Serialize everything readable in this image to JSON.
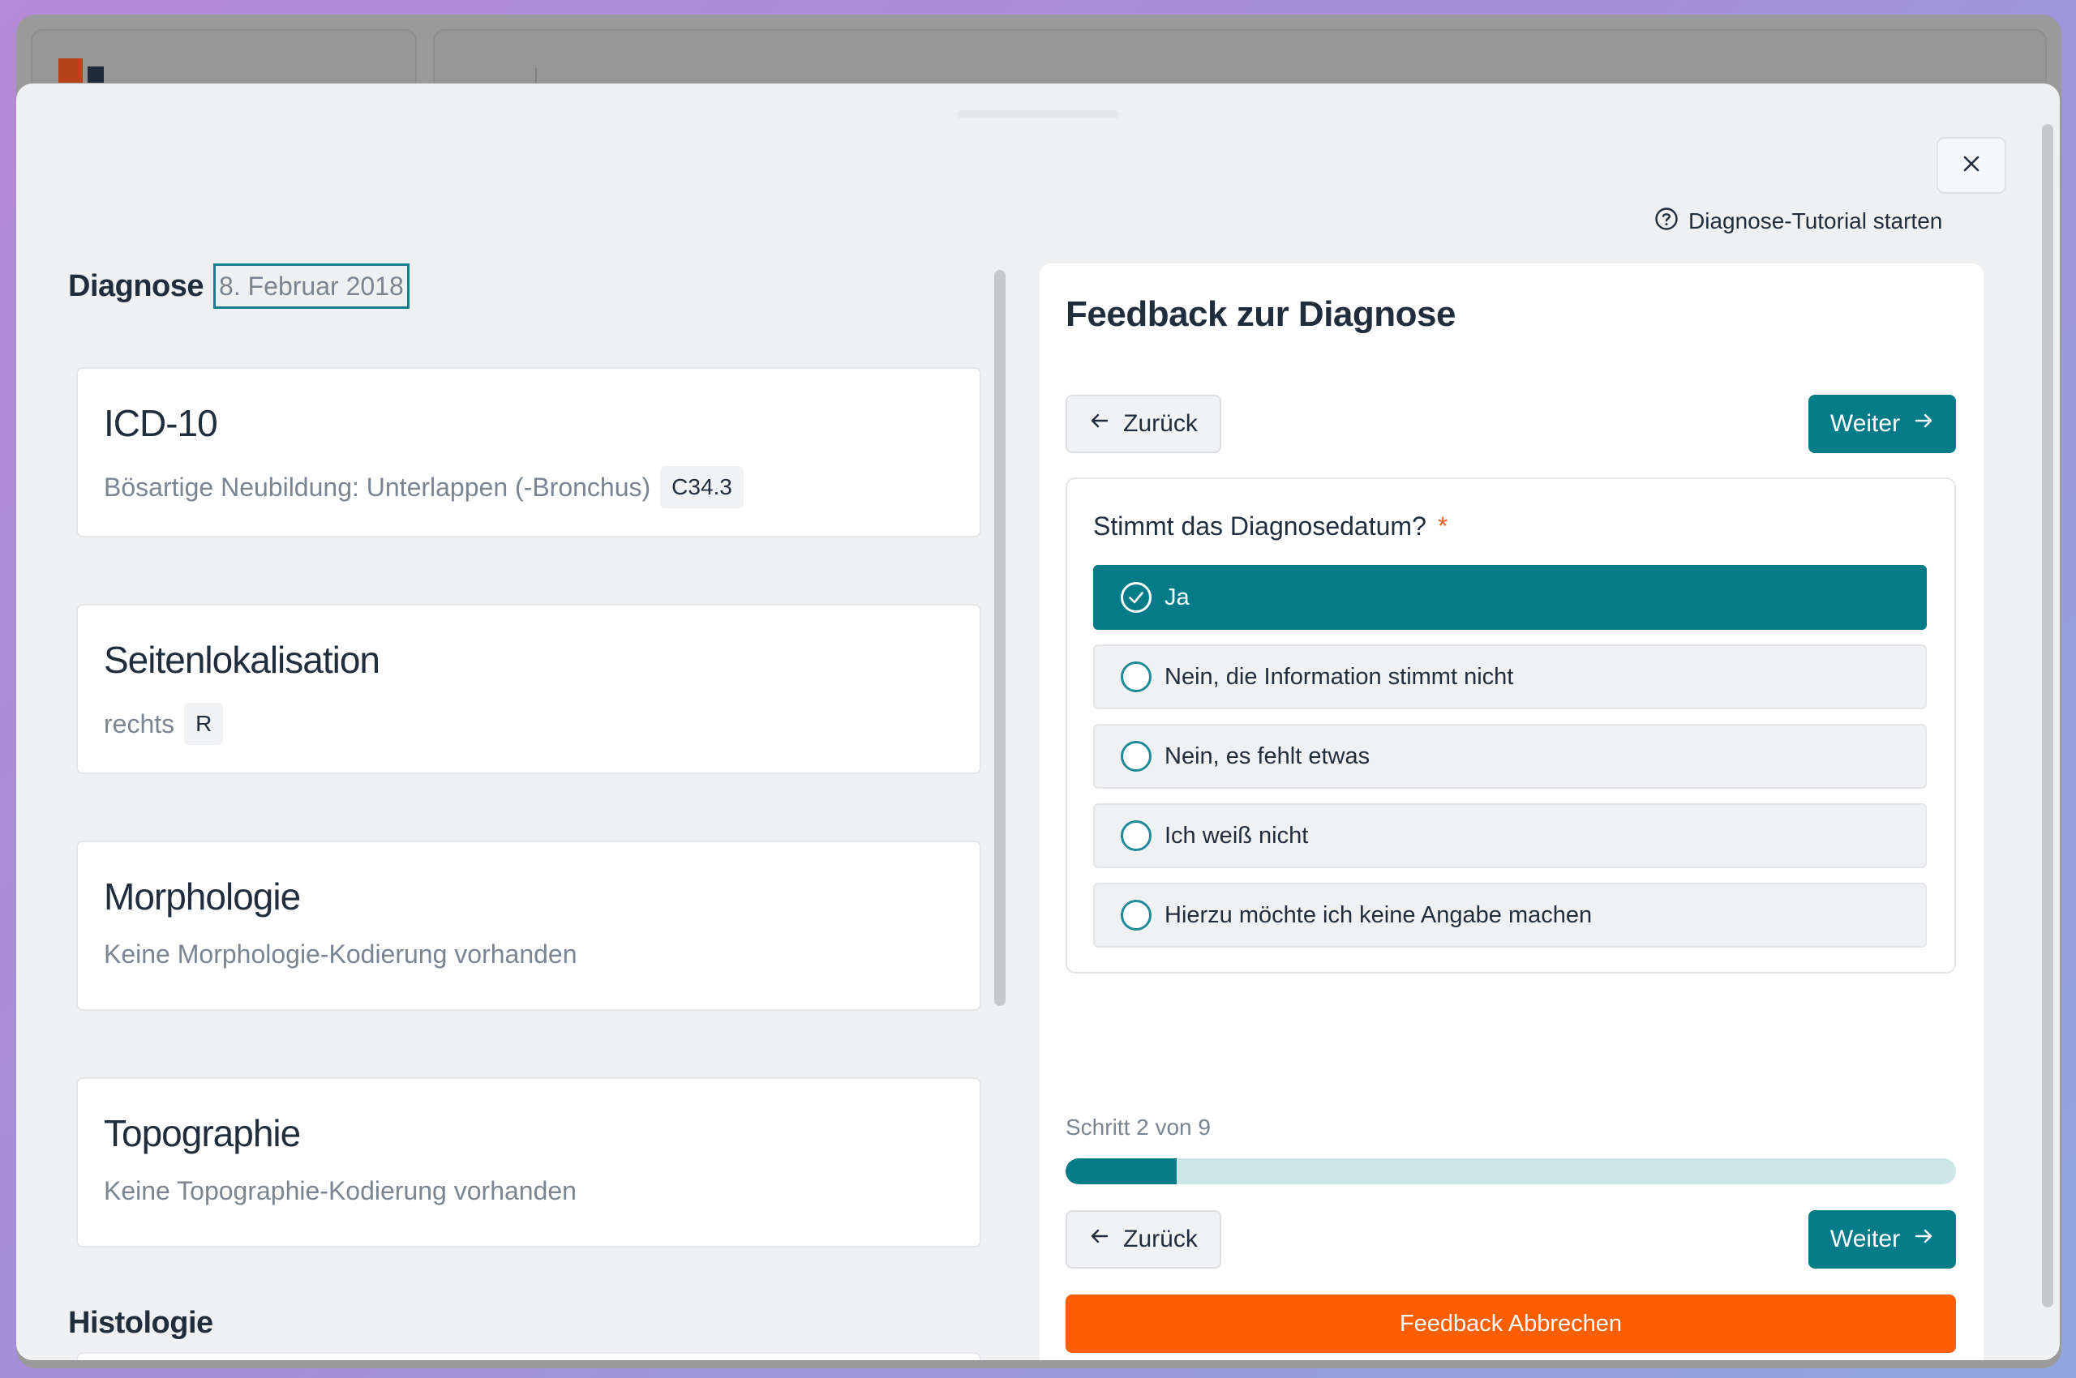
{
  "colors": {
    "accent": "#037b89",
    "cancel": "#ff5f03",
    "required": "#f0622a",
    "progress_track": "#cce5e9"
  },
  "close_icon": "close-icon",
  "tutorial": {
    "icon": "help-circle-icon",
    "label": "Diagnose-Tutorial starten"
  },
  "diagnosis": {
    "title": "Diagnose",
    "date": "8. Februar 2018"
  },
  "cards": [
    {
      "title": "ICD-10",
      "text": "Bösartige Neubildung: Unterlappen (-Bronchus)",
      "code": "C34.3"
    },
    {
      "title": "Seitenlokalisation",
      "text": "rechts",
      "code": "R"
    },
    {
      "title": "Morphologie",
      "text": "Keine Morphologie-Kodierung vorhanden"
    },
    {
      "title": "Topographie",
      "text": "Keine Topographie-Kodierung vorhanden"
    }
  ],
  "histology": {
    "title": "Histologie"
  },
  "feedback": {
    "title": "Feedback zur Diagnose",
    "back_label": "Zurück",
    "next_label": "Weiter",
    "question": "Stimmt das Diagnosedatum?",
    "required_mark": "*",
    "options": [
      {
        "label": "Ja",
        "selected": true
      },
      {
        "label": "Nein, die Information stimmt nicht",
        "selected": false
      },
      {
        "label": "Nein, es fehlt etwas",
        "selected": false
      },
      {
        "label": "Ich weiß nicht",
        "selected": false
      },
      {
        "label": "Hierzu möchte ich keine Angabe machen",
        "selected": false
      }
    ],
    "step_text": "Schritt 2 von 9",
    "progress": {
      "current": 2,
      "total": 9,
      "fraction": 0.125
    },
    "cancel_label": "Feedback Abbrechen"
  }
}
